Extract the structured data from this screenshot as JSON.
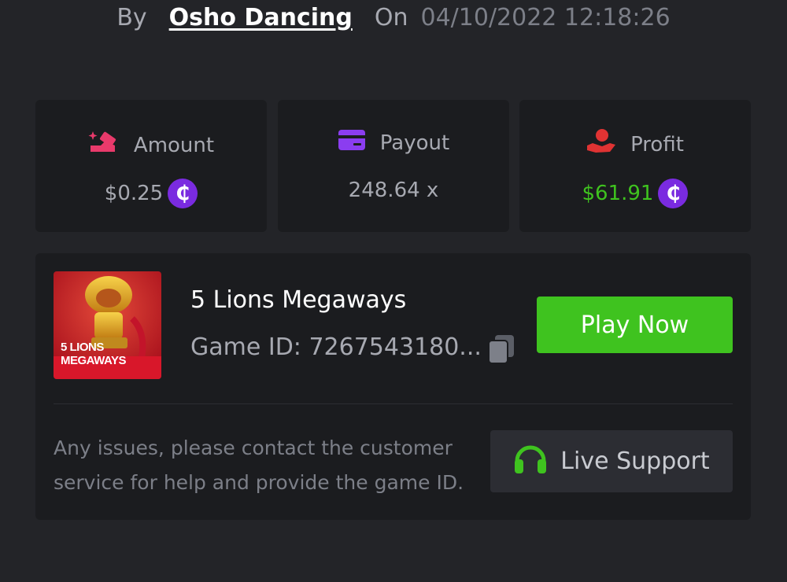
{
  "header": {
    "by_label": "By",
    "username": "Osho Dancing",
    "on_label": "On",
    "datetime": "04/10/2022 12:18:26"
  },
  "stats": {
    "amount": {
      "label": "Amount",
      "value": "$0.25",
      "icon": "bet-amount-icon"
    },
    "payout": {
      "label": "Payout",
      "value": "248.64 x",
      "icon": "card-icon"
    },
    "profit": {
      "label": "Profit",
      "value": "$61.91",
      "icon": "hand-coin-icon"
    },
    "currency_symbol": "₵"
  },
  "game": {
    "title": "5 Lions Megaways",
    "id_text": "Game ID: 7267543180...",
    "thumb_text_line1": "5 LIONS",
    "thumb_text_line2": "MEGAWAYS",
    "play_label": "Play Now"
  },
  "support": {
    "help_text": "Any issues, please contact the customer service for help and provide the game ID.",
    "button_label": "Live Support"
  },
  "colors": {
    "background": "#232428",
    "card": "#1b1c1f",
    "accent_green": "#3fc31f",
    "coin_purple": "#7a2be0",
    "amount_pink": "#e83a6b",
    "payout_purple": "#8b3df0",
    "profit_red": "#e03333"
  }
}
